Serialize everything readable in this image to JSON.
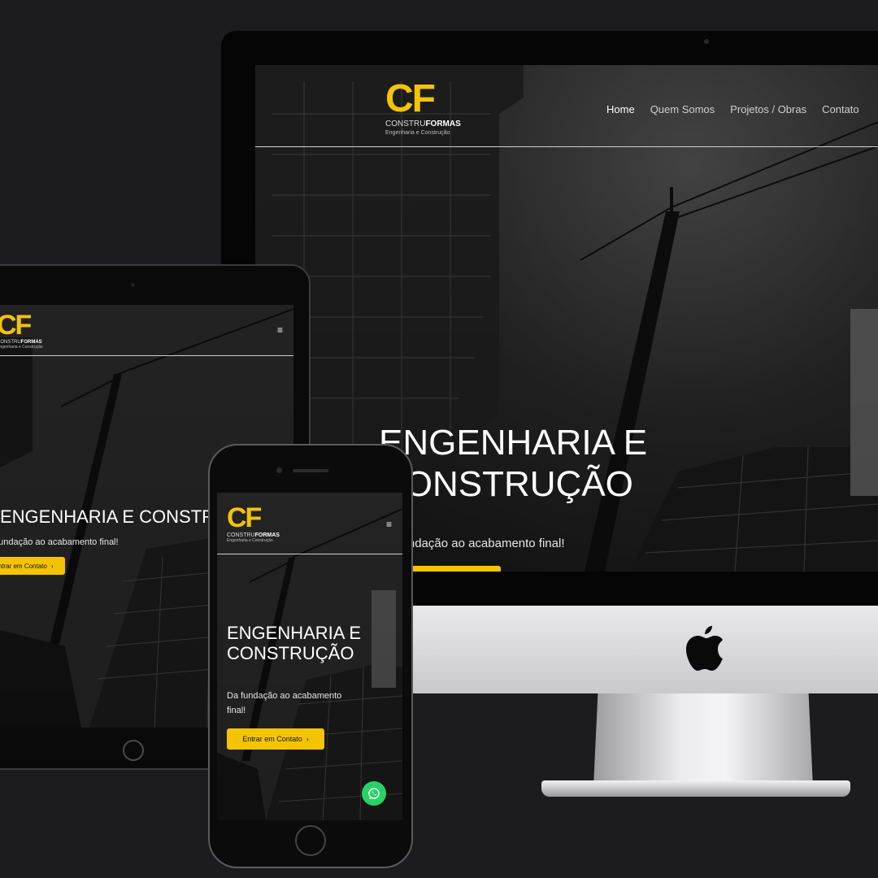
{
  "brand": {
    "mark": "CF",
    "name_prefix": "CONSTRU",
    "name_bold": "FORMAS",
    "tagline": "Engenharia e Construção"
  },
  "nav": {
    "items": [
      "Home",
      "Quem Somos",
      "Projetos / Obras",
      "Contato"
    ],
    "menu_icon": "≡"
  },
  "hero": {
    "title_line1": "ENGENHARIA E",
    "title_line2": "CONSTRUÇÃO",
    "title_single": "ENGENHARIA E CONSTRUÇÃO",
    "subtitle": "Da fundação ao acabamento final!",
    "subtitle_line1": "Da fundação ao acabamento",
    "subtitle_line2": "final!",
    "cta_label": "Entrar em Contato",
    "cta_icon": "›"
  },
  "colors": {
    "accent": "#f5c400",
    "background": "#1c1c1f",
    "whatsapp": "#25d366"
  },
  "icons": [
    "apple-icon",
    "whatsapp-icon",
    "menu-icon",
    "chevron-right-icon"
  ]
}
